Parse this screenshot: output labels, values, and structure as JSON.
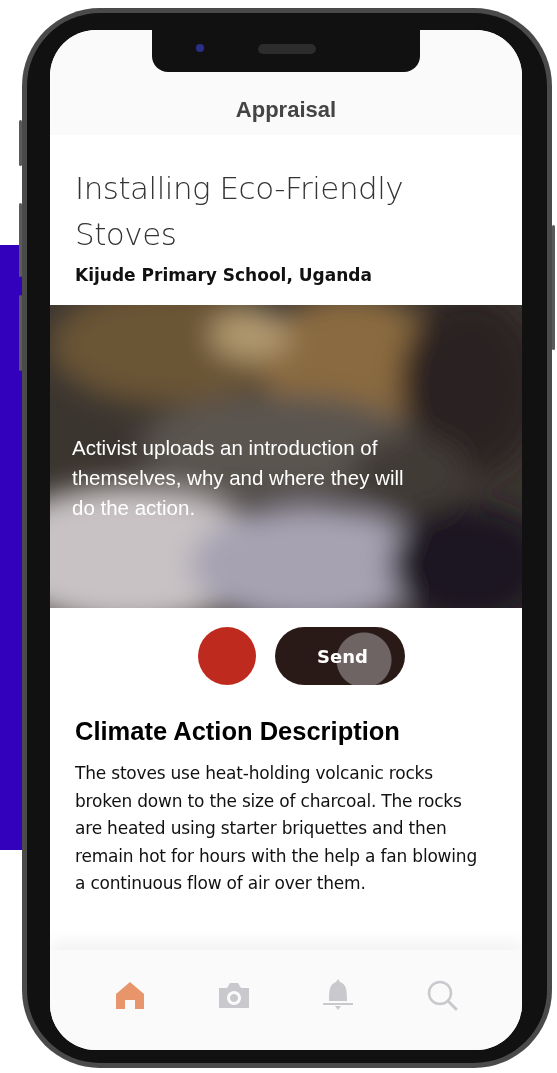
{
  "header": {
    "title": "Appraisal"
  },
  "project": {
    "title": "Installing Eco-Friendly Stoves",
    "location": "Kijude Primary School, Uganda"
  },
  "video": {
    "caption": "Activist uploads an introduction of themselves, why and where they will do the action."
  },
  "actions": {
    "send_label": "Send"
  },
  "description": {
    "heading": "Climate Action Description",
    "text": "The stoves use heat-holding volcanic rocks broken down to the size of charcoal. The rocks are heated using starter briquettes and then remain hot for hours with the help a fan blowing a continuous flow of air over them."
  },
  "nav": [
    {
      "kind": "home",
      "selected": true
    },
    {
      "kind": "camera",
      "selected": false
    },
    {
      "kind": "bell",
      "selected": false
    },
    {
      "kind": "search",
      "selected": false
    }
  ]
}
